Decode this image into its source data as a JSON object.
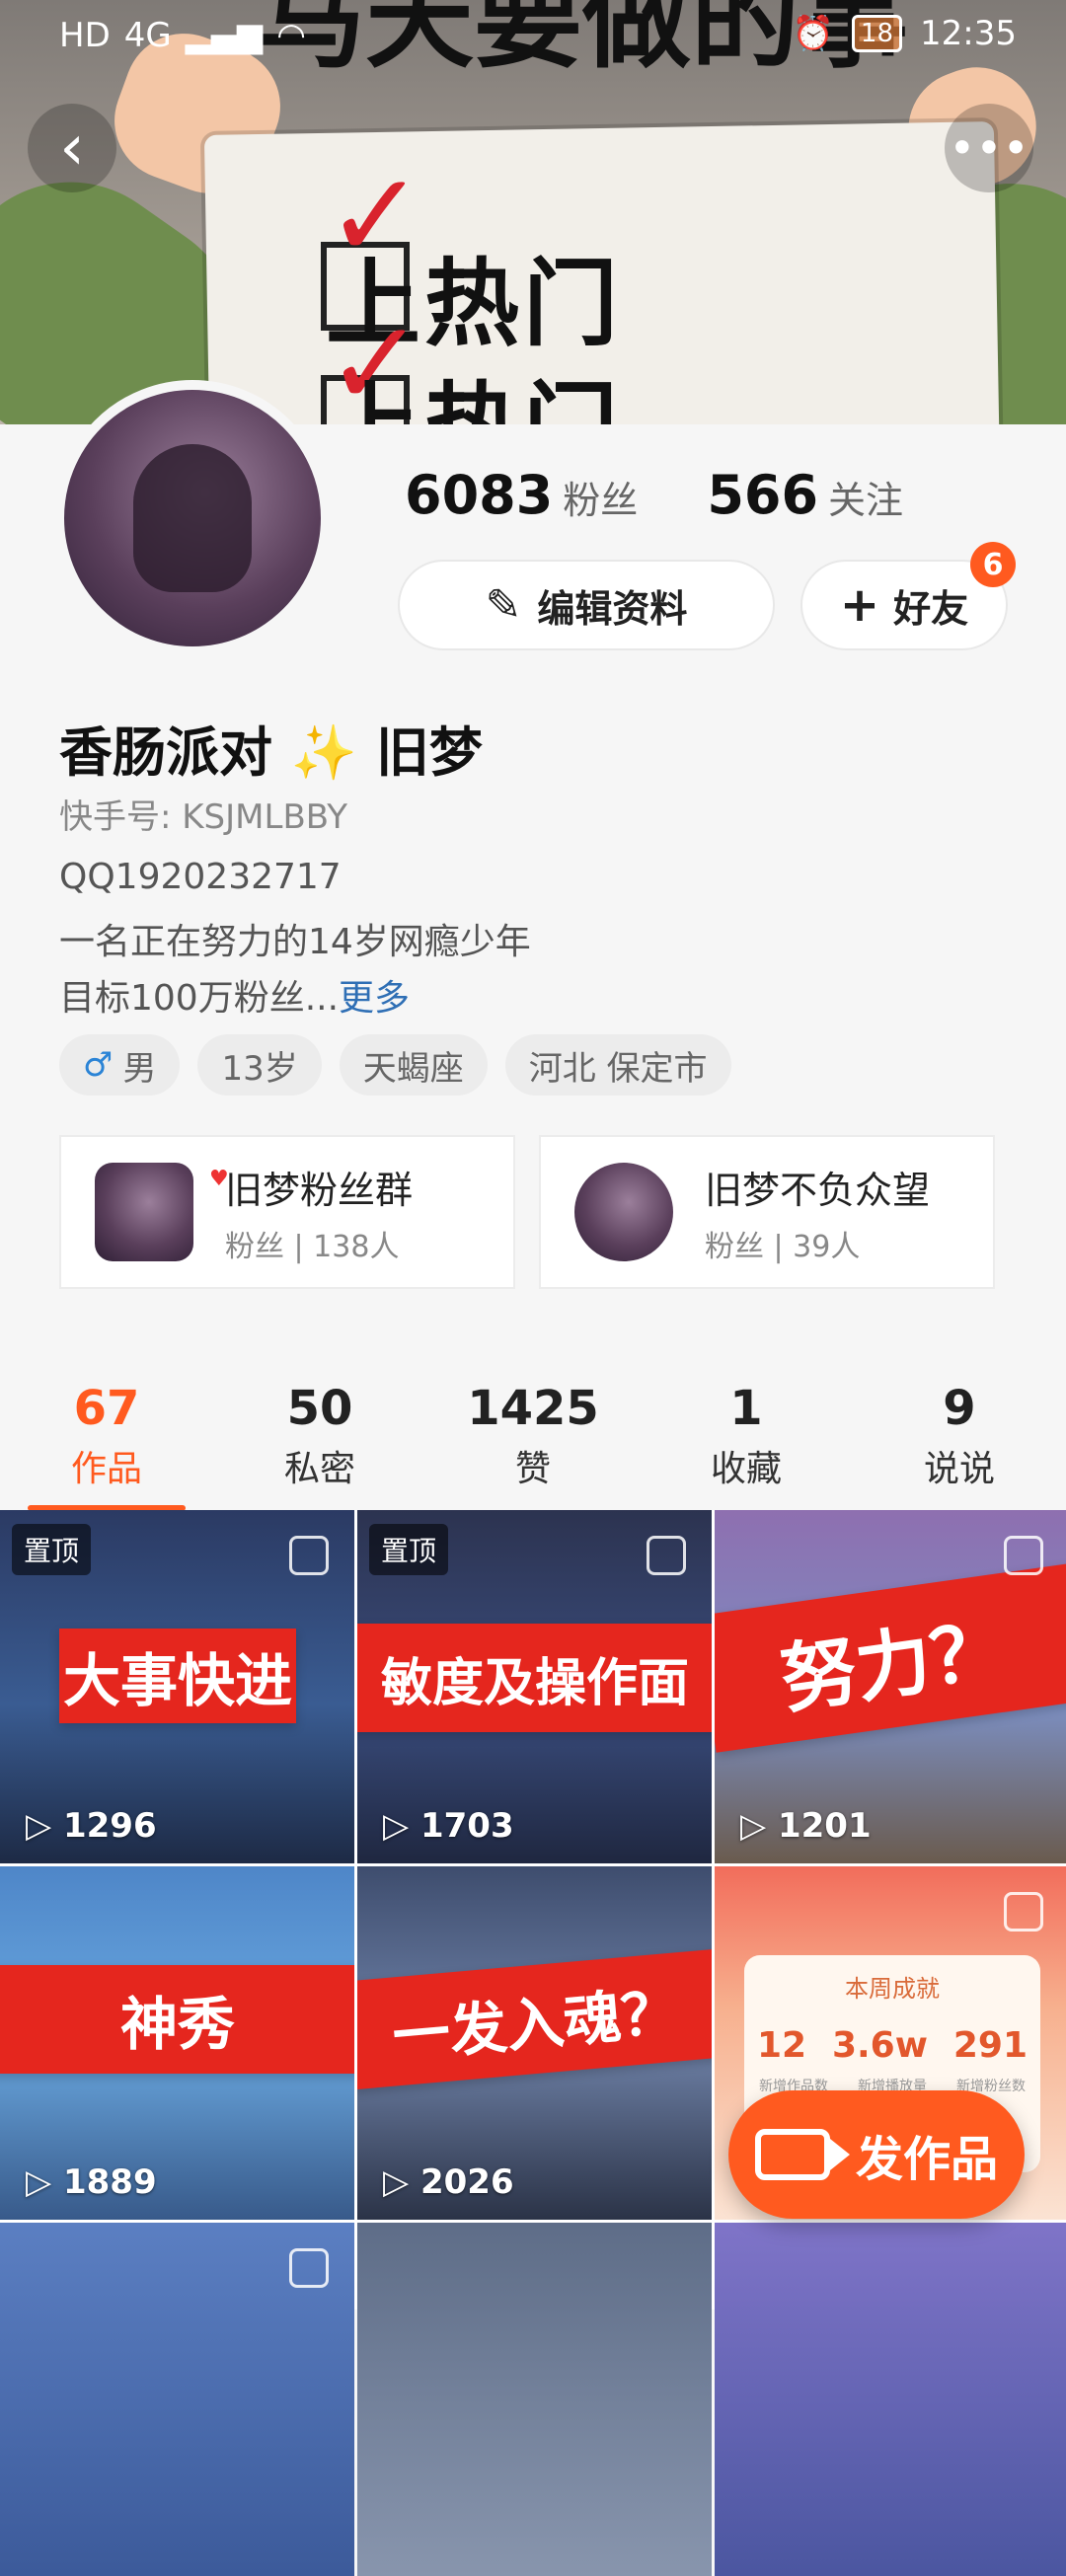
{
  "status_bar": {
    "left_icons": [
      "HD",
      "4G",
      "signal-icon",
      "wifi-icon"
    ],
    "battery": "18",
    "time": "12:35"
  },
  "banner": {
    "line1": "上热门",
    "line2": "上热门",
    "top_text": "马天要做的事"
  },
  "header": {
    "back_icon": "back-icon",
    "more_icon": "more-icon"
  },
  "profile": {
    "followers_value": "6083",
    "followers_label": "粉丝",
    "following_value": "566",
    "following_label": "关注",
    "edit_button": "编辑资料",
    "friends_button": "好友",
    "friends_badge": "6",
    "name_part1": "香肠派对",
    "name_sparkle": "✨",
    "name_part2": "旧梦",
    "kuaishou_id": "快手号: KSJMLBBY",
    "bio_line1": "QQ1920232717",
    "bio_line2": "一名正在努力的14岁网瘾少年",
    "bio_line3": "目标100万粉丝...",
    "bio_more": "更多"
  },
  "tags": {
    "gender": "男",
    "age": "13岁",
    "zodiac": "天蝎座",
    "location": "河北 保定市"
  },
  "groups": [
    {
      "title": "旧梦粉丝群",
      "sub": "粉丝 | 138人"
    },
    {
      "title": "旧梦不负众望",
      "sub": "粉丝 | 39人"
    }
  ],
  "tabs": [
    {
      "num": "67",
      "label": "作品"
    },
    {
      "num": "50",
      "label": "私密"
    },
    {
      "num": "1425",
      "label": "赞"
    },
    {
      "num": "1",
      "label": "收藏"
    },
    {
      "num": "9",
      "label": "说说"
    }
  ],
  "videos": [
    {
      "title": "大事快进",
      "plays": "1296",
      "pinned": "置顶"
    },
    {
      "title": "敏度及操作面",
      "plays": "1703",
      "pinned": "置顶"
    },
    {
      "title": "努力？",
      "plays": "1201"
    },
    {
      "title": "神秀",
      "plays": "1889"
    },
    {
      "title": "一发入魂？",
      "plays": "2026"
    },
    {
      "title": "本周成就"
    }
  ],
  "weekly": {
    "works": "12",
    "works_label": "新增作品数",
    "plays": "3.6w",
    "plays_label": "新增播放量",
    "fans": "291",
    "fans_label": "新增粉丝数"
  },
  "fab": {
    "label": "发作品"
  },
  "colors": {
    "accent": "#ff5a1f",
    "link": "#2f6fb5",
    "red_banner": "#e5261e"
  }
}
